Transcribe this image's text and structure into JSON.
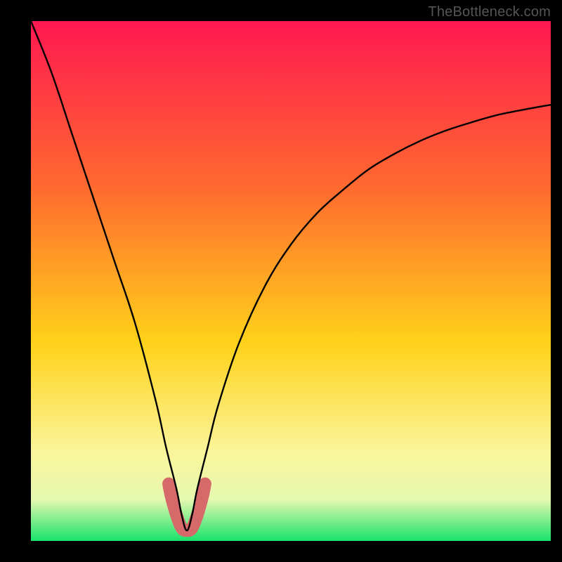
{
  "watermark": "TheBottleneck.com",
  "colors": {
    "gradient_top": "#ff1851",
    "gradient_upper_mid": "#ff6a2f",
    "gradient_mid": "#ffd21a",
    "gradient_lower_mid": "#faf59b",
    "gradient_near_bottom": "#e6f8b0",
    "gradient_bottom": "#17e36b",
    "curve": "#000000",
    "highlight": "#d66a6a",
    "frame": "#000000"
  },
  "plot": {
    "x_domain": [
      0,
      100
    ],
    "y_domain": [
      0,
      100
    ],
    "minimum_x": 30
  },
  "chart_data": {
    "type": "line",
    "title": "",
    "xlabel": "",
    "ylabel": "",
    "xlim": [
      0,
      100
    ],
    "ylim": [
      0,
      100
    ],
    "series": [
      {
        "name": "bottleneck-curve",
        "x": [
          0,
          4,
          8,
          12,
          16,
          20,
          24,
          26,
          28,
          29,
          30,
          31,
          32,
          34,
          36,
          40,
          45,
          50,
          55,
          60,
          65,
          70,
          75,
          80,
          85,
          90,
          95,
          100
        ],
        "values": [
          100,
          90,
          78,
          66,
          54,
          42,
          27,
          18,
          10,
          5,
          2,
          5,
          10,
          18,
          26,
          38,
          49,
          57,
          63,
          67.5,
          71.5,
          74.5,
          77,
          79,
          80.6,
          82,
          83,
          83.9
        ]
      },
      {
        "name": "highlight-region",
        "x": [
          26.5,
          27,
          28,
          29,
          30,
          31,
          32,
          33,
          33.5
        ],
        "values": [
          11,
          8.5,
          5,
          2.5,
          2,
          2.5,
          5,
          8.5,
          11
        ]
      }
    ],
    "annotations": []
  }
}
